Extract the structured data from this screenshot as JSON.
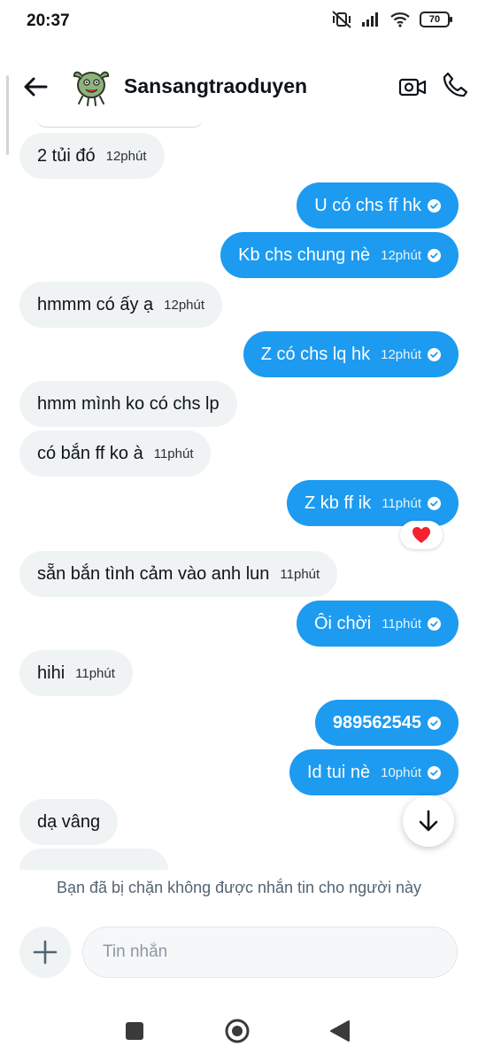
{
  "status_bar": {
    "time": "20:37",
    "battery": "70"
  },
  "header": {
    "contact_name": "Sansangtraoduyen",
    "back_icon": "arrow-left-icon",
    "video_icon": "video-camera-icon",
    "call_icon": "phone-icon"
  },
  "messages": [
    {
      "dir": "in",
      "text": "2 tủi đó",
      "time": "12phút"
    },
    {
      "dir": "out",
      "text": "U có chs ff hk",
      "time": ""
    },
    {
      "dir": "out",
      "text": "Kb chs chung nè",
      "time": "12phút"
    },
    {
      "dir": "in",
      "text": "hmmm có ấy ạ",
      "time": "12phút"
    },
    {
      "dir": "out",
      "text": "Z có chs lq hk",
      "time": "12phút"
    },
    {
      "dir": "in",
      "text": "hmm mình ko có chs lp",
      "time": ""
    },
    {
      "dir": "in",
      "text": "có bắn ff ko à",
      "time": "11phút"
    },
    {
      "dir": "out",
      "text": "Z kb ff ik",
      "time": "11phút"
    },
    {
      "dir": "in",
      "text": "sẵn bắn tình cảm vào anh lun",
      "time": "11phút"
    },
    {
      "dir": "out",
      "text": "Ôi chời",
      "time": "11phút"
    },
    {
      "dir": "in",
      "text": "hihi",
      "time": "11phút"
    },
    {
      "dir": "out",
      "text": "989562545",
      "time": ""
    },
    {
      "dir": "out",
      "text": "Id tui nè",
      "time": "10phút"
    },
    {
      "dir": "in",
      "text": "dạ vâng",
      "time": ""
    }
  ],
  "reaction": {
    "emoji": "heart",
    "color": "#f4212e"
  },
  "blocked_notice": "Bạn đã bị chặn không được nhắn tin cho người này",
  "composer": {
    "placeholder": "Tin nhắn"
  },
  "colors": {
    "accent": "#1d9bf0",
    "incoming_bubble": "#eff3f4"
  }
}
